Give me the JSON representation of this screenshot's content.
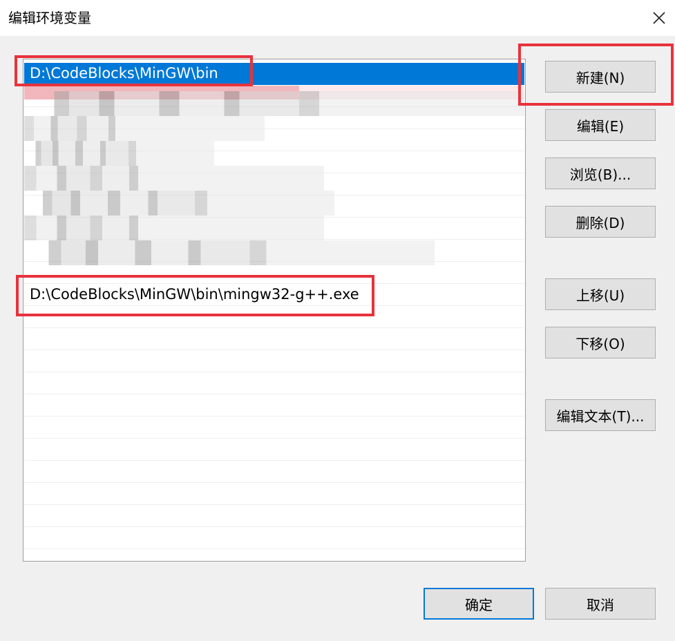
{
  "window": {
    "title": "编辑环境变量",
    "close_icon": "close-icon"
  },
  "list": {
    "items": [
      {
        "text": "D:\\CodeBlocks\\MinGW\\bin",
        "selected": true
      },
      {
        "text": "D:\\CodeBlocks\\MinGW\\bin\\mingw32-g++.exe",
        "selected": false
      }
    ]
  },
  "buttons": {
    "new": "新建(N)",
    "edit": "编辑(E)",
    "browse": "浏览(B)...",
    "delete": "删除(D)",
    "move_up": "上移(U)",
    "move_down": "下移(O)",
    "edit_text": "编辑文本(T)...",
    "ok": "确定",
    "cancel": "取消"
  },
  "colors": {
    "selection": "#0078d7",
    "annotation_red": "#e8323c"
  }
}
